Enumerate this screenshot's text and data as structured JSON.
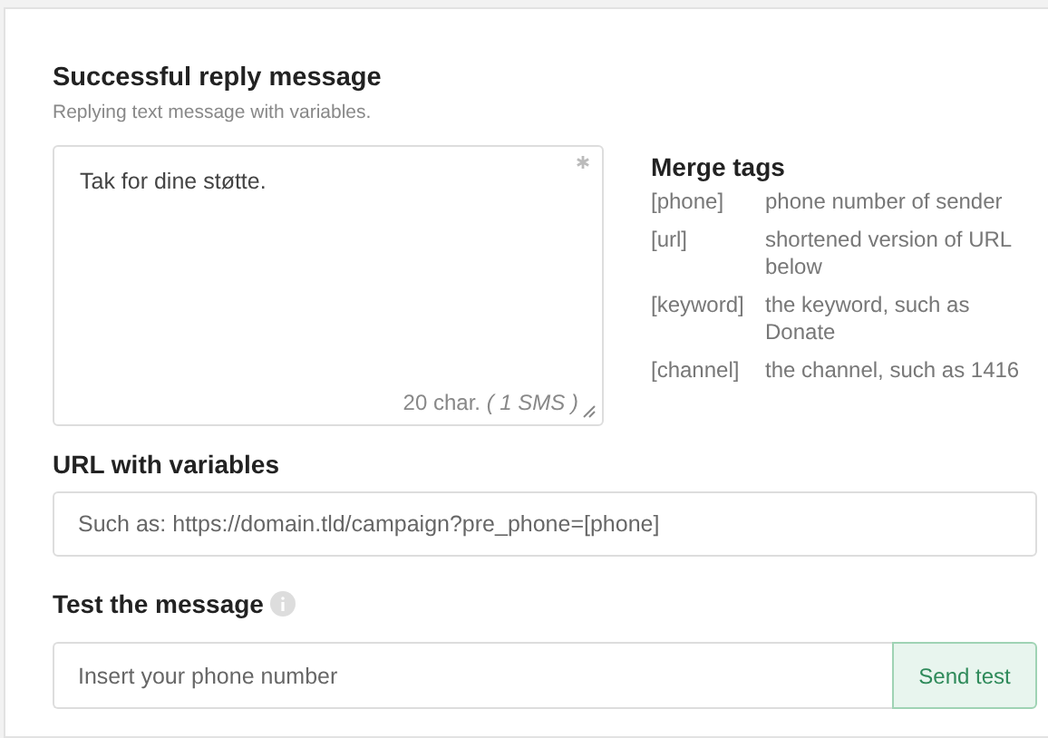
{
  "reply": {
    "title": "Successful reply message",
    "subtitle": "Replying text message with variables.",
    "message": {
      "value": "Tak for dine støtte.",
      "required": true,
      "counter": "20 char. *( 1 SMS )*"
    }
  },
  "merge_tags": {
    "title": "Merge tags",
    "rows": [
      {
        "tag": "[phone]",
        "description": "phone number of sender"
      },
      {
        "tag": "[url]",
        "description": "shortened version of URL below"
      },
      {
        "tag": "[keyword]",
        "description": "the keyword, such as Donate"
      },
      {
        "tag": "[channel]",
        "description": "the channel, such as 1416"
      }
    ]
  },
  "url": {
    "label": "URL with variables",
    "placeholder": "Such as: https://domain.tld/campaign?pre_phone=[phone]"
  },
  "test": {
    "label": "Test the message",
    "info": true,
    "placeholder": "Insert your phone number",
    "button": "Send test"
  }
}
